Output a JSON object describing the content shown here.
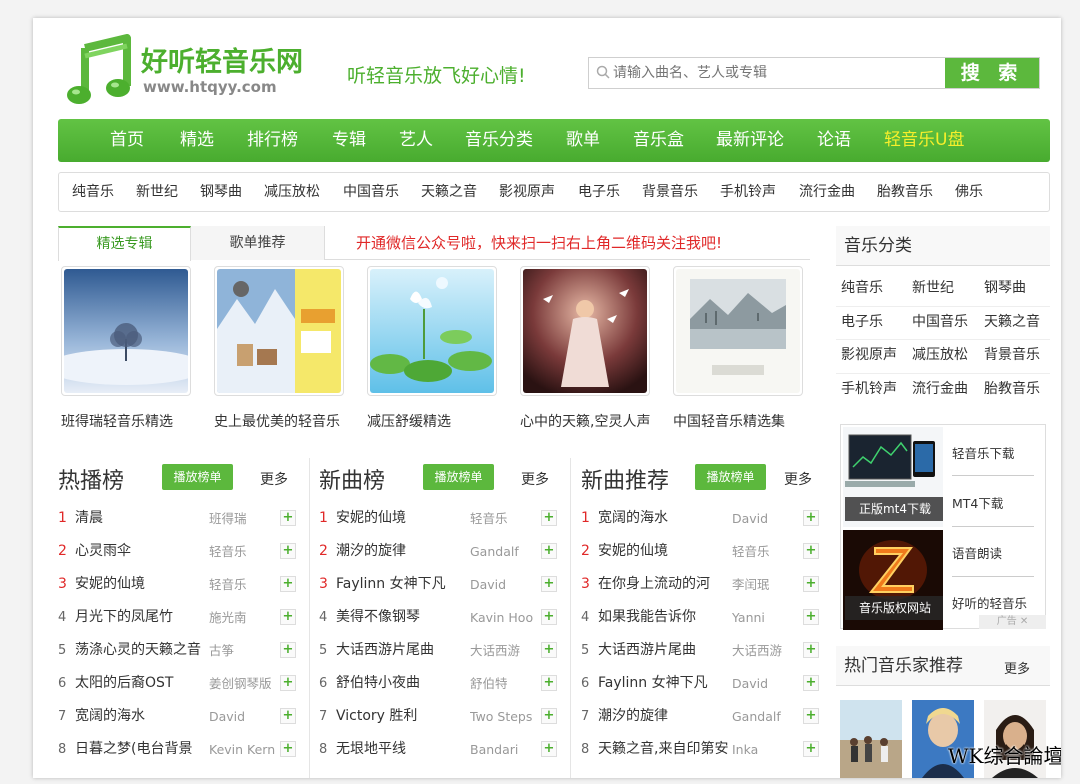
{
  "site": {
    "name": "好听轻音乐网",
    "domain": "www.htqyy.com",
    "slogan": "听轻音乐放飞好心情!",
    "accent": "#4caf2e"
  },
  "search": {
    "placeholder": "请输入曲名、艺人或专辑",
    "button": "搜 索"
  },
  "main_nav": [
    {
      "label": "首页"
    },
    {
      "label": "精选"
    },
    {
      "label": "排行榜"
    },
    {
      "label": "专辑"
    },
    {
      "label": "艺人"
    },
    {
      "label": "音乐分类"
    },
    {
      "label": "歌单"
    },
    {
      "label": "音乐盒"
    },
    {
      "label": "最新评论"
    },
    {
      "label": "论语"
    },
    {
      "label": "轻音乐U盘",
      "highlight": "#f6ef2b"
    }
  ],
  "genres": [
    "纯音乐",
    "新世纪",
    "钢琴曲",
    "减压放松",
    "中国音乐",
    "天籁之音",
    "影视原声",
    "电子乐",
    "背景音乐",
    "手机铃声",
    "流行金曲",
    "胎教音乐",
    "佛乐"
  ],
  "featured": {
    "tabs": [
      "精选专辑",
      "歌单推荐"
    ],
    "notice": "开通微信公众号啦，快来扫一扫右上角二维码关注我吧!",
    "albums": [
      {
        "title": "班得瑞轻音乐精选"
      },
      {
        "title": "史上最优美的轻音乐"
      },
      {
        "title": "减压舒缓精选"
      },
      {
        "title": "心中的天籁,空灵人声"
      },
      {
        "title": "中国轻音乐精选集"
      }
    ]
  },
  "charts": [
    {
      "title": "热播榜",
      "play": "播放榜单",
      "more": "更多",
      "rows": [
        {
          "rank": "1",
          "song": "清晨",
          "artist": "班得瑞"
        },
        {
          "rank": "2",
          "song": "心灵雨伞",
          "artist": "轻音乐"
        },
        {
          "rank": "3",
          "song": "安妮的仙境",
          "artist": "轻音乐"
        },
        {
          "rank": "4",
          "song": "月光下的凤尾竹",
          "artist": "施光南"
        },
        {
          "rank": "5",
          "song": "荡涤心灵的天籁之音",
          "artist": "古筝"
        },
        {
          "rank": "6",
          "song": "太阳的后裔OST",
          "artist": "姜创钢琴版"
        },
        {
          "rank": "7",
          "song": "宽阔的海水",
          "artist": "David"
        },
        {
          "rank": "8",
          "song": "日暮之梦(电台背景",
          "artist": "Kevin Kern"
        }
      ]
    },
    {
      "title": "新曲榜",
      "play": "播放榜单",
      "more": "更多",
      "rows": [
        {
          "rank": "1",
          "song": "安妮的仙境",
          "artist": "轻音乐"
        },
        {
          "rank": "2",
          "song": "潮汐的旋律",
          "artist": "Gandalf"
        },
        {
          "rank": "3",
          "song": "Faylinn 女神下凡",
          "artist": "David"
        },
        {
          "rank": "4",
          "song": "美得不像钢琴",
          "artist": "Kavin Hoo"
        },
        {
          "rank": "5",
          "song": "大话西游片尾曲",
          "artist": "大话西游"
        },
        {
          "rank": "6",
          "song": "舒伯特小夜曲",
          "artist": "舒伯特"
        },
        {
          "rank": "7",
          "song": "Victory 胜利",
          "artist": "Two Steps"
        },
        {
          "rank": "8",
          "song": "无垠地平线",
          "artist": "Bandari"
        }
      ]
    },
    {
      "title": "新曲推荐",
      "play": "播放榜单",
      "more": "更多",
      "rows": [
        {
          "rank": "1",
          "song": "宽阔的海水",
          "artist": "David"
        },
        {
          "rank": "2",
          "song": "安妮的仙境",
          "artist": "轻音乐"
        },
        {
          "rank": "3",
          "song": "在你身上流动的河",
          "artist": "李闰珉"
        },
        {
          "rank": "4",
          "song": "如果我能告诉你",
          "artist": "Yanni"
        },
        {
          "rank": "5",
          "song": "大话西游片尾曲",
          "artist": "大话西游"
        },
        {
          "rank": "6",
          "song": "Faylinn 女神下凡",
          "artist": "David"
        },
        {
          "rank": "7",
          "song": "潮汐的旋律",
          "artist": "Gandalf"
        },
        {
          "rank": "8",
          "song": "天籁之音,来自印第安",
          "artist": "Inka"
        }
      ]
    }
  ],
  "sidebar": {
    "category_title": "音乐分类",
    "categories": [
      "纯音乐",
      "新世纪",
      "钢琴曲",
      "电子乐",
      "中国音乐",
      "天籁之音",
      "影视原声",
      "减压放松",
      "背景音乐",
      "手机铃声",
      "流行金曲",
      "胎教音乐"
    ],
    "ads": [
      {
        "caption": "正版mt4下载"
      },
      {
        "caption": "音乐版权网站"
      }
    ],
    "ad_links": [
      "轻音乐下载",
      "MT4下载",
      "语音朗读",
      "好听的轻音乐"
    ],
    "ad_badge": "广告 ✕",
    "musician_title": "热门音乐家推荐",
    "musician_more": "更多"
  },
  "watermark": "WK综合論壇"
}
